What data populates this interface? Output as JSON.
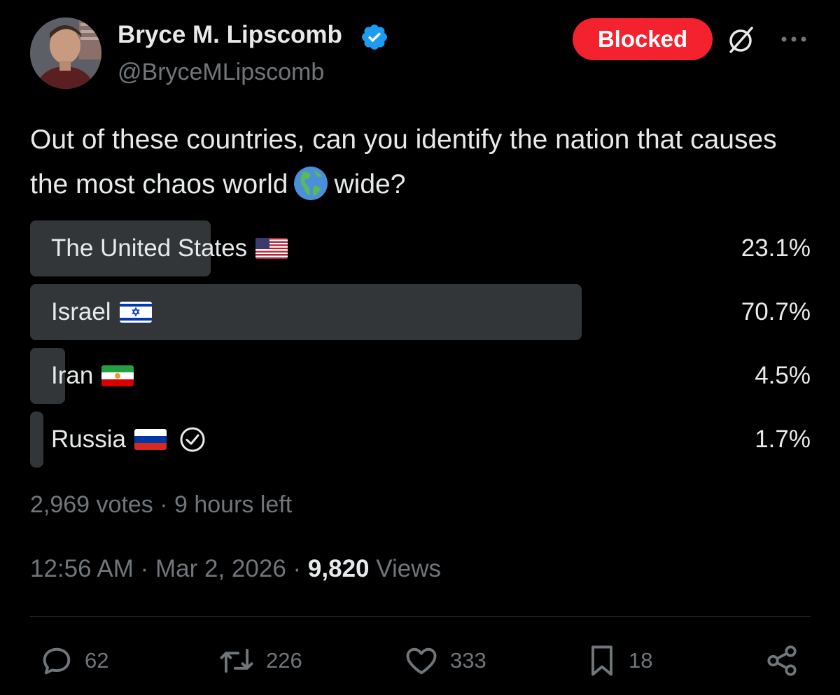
{
  "author": {
    "name": "Bryce M. Lipscomb",
    "handle": "@BryceMLipscomb"
  },
  "header": {
    "blocked_label": "Blocked"
  },
  "tweet": {
    "text_before_emoji": "Out of these countries, can you identify the nation that causes the most chaos world",
    "emoji": "globe-americas-icon",
    "text_after_emoji": "wide?"
  },
  "poll": {
    "options": [
      {
        "label": "The United States",
        "percent_label": "23.1%",
        "percent": 23.1,
        "flag": "flag-us-icon"
      },
      {
        "label": "Israel",
        "percent_label": "70.7%",
        "percent": 70.7,
        "flag": "flag-israel-icon"
      },
      {
        "label": "Iran",
        "percent_label": "4.5%",
        "percent": 4.5,
        "flag": "flag-iran-icon"
      },
      {
        "label": "Russia",
        "percent_label": "1.7%",
        "percent": 1.7,
        "flag": "flag-russia-icon",
        "selected": true
      }
    ],
    "votes_label": "2,969 votes · 9 hours left"
  },
  "meta": {
    "time": "12:56 AM",
    "date": "Mar 2, 2026",
    "views_count": "9,820",
    "views_label": "Views"
  },
  "actions": {
    "replies": "62",
    "reposts": "226",
    "likes": "333",
    "bookmarks": "18"
  },
  "colors": {
    "background": "#000000",
    "text": "#e7e9ea",
    "muted": "#71767b",
    "poll_fill": "#333639",
    "blocked": "#f4212e",
    "verified": "#1d9bf0"
  }
}
